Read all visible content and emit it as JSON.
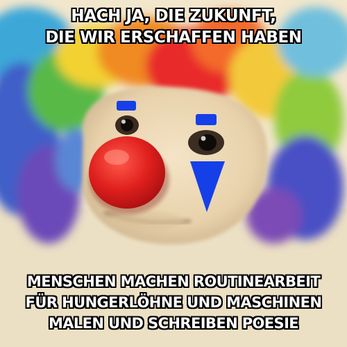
{
  "meme": {
    "top_text": [
      "HACH JA, DIE ZUKUNFT,",
      "DIE WIR ERSCHAFFEN HABEN"
    ],
    "bottom_text": [
      "MENSCHEN MACHEN ROUTINEARBEIT",
      "FÜR HUNGERLÖHNE UND MASCHINEN",
      "MALEN UND SCHREIBEN POESIE"
    ]
  },
  "colors": {
    "nose": "#e0201e",
    "eye_paint": "#1540e8",
    "fur": "#ead7b4",
    "caption_text": "#ffffff",
    "caption_outline": "#000000"
  }
}
